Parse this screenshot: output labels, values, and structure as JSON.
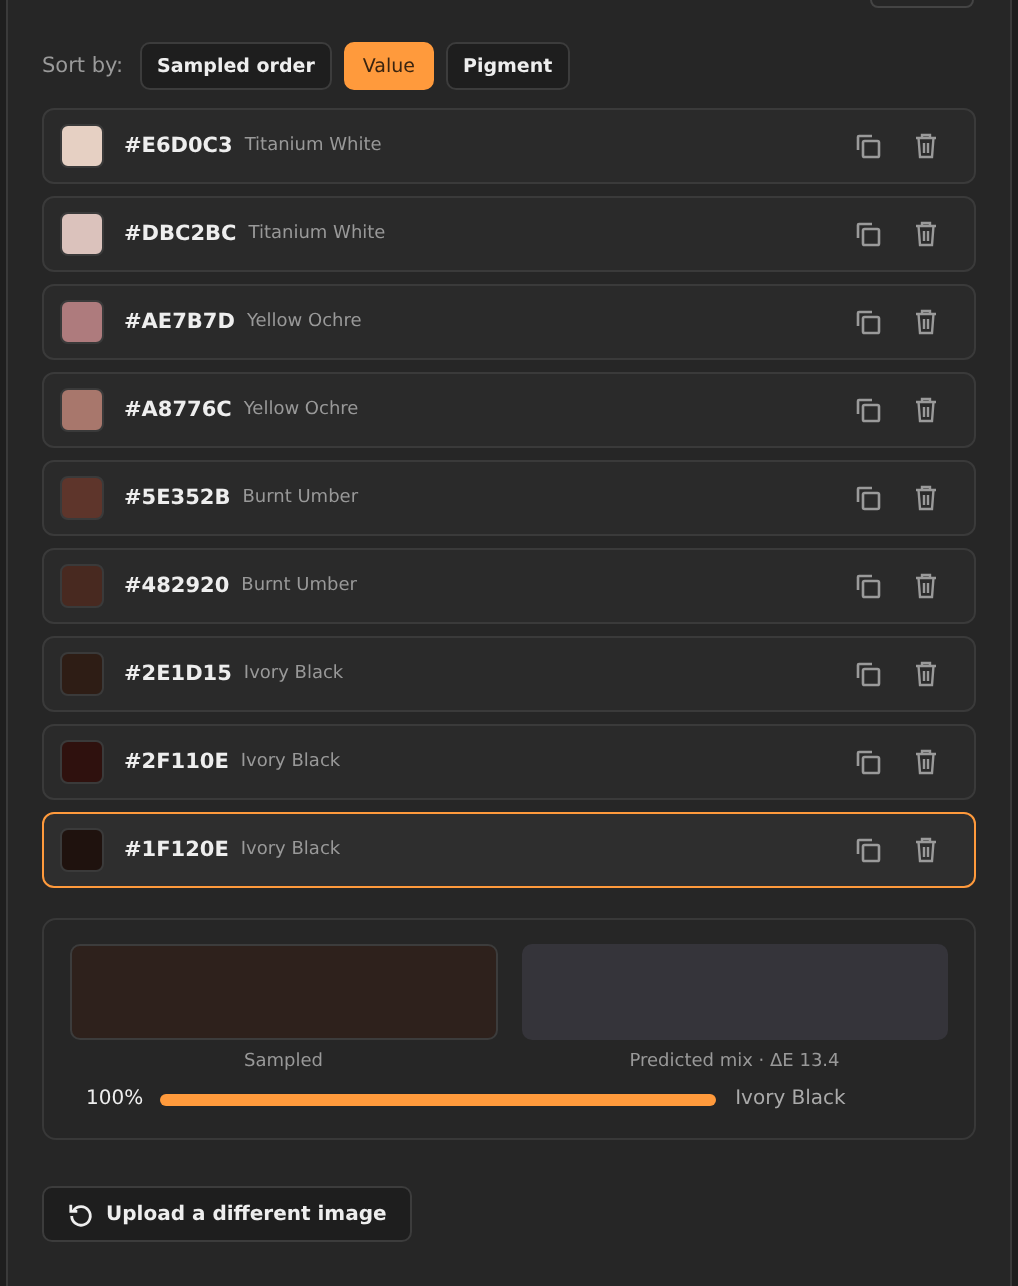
{
  "sort": {
    "label": "Sort by:",
    "options": [
      {
        "label": "Sampled order",
        "selected": false
      },
      {
        "label": "Value",
        "selected": true
      },
      {
        "label": "Pigment",
        "selected": false
      }
    ]
  },
  "rows": [
    {
      "hex": "#E6D0C3",
      "pigment": "Titanium White",
      "color": "#e6d0c3",
      "selected": false
    },
    {
      "hex": "#DBC2BC",
      "pigment": "Titanium White",
      "color": "#dbc2bc",
      "selected": false
    },
    {
      "hex": "#AE7B7D",
      "pigment": "Yellow Ochre",
      "color": "#ae7b7d",
      "selected": false
    },
    {
      "hex": "#A8776C",
      "pigment": "Yellow Ochre",
      "color": "#a8776c",
      "selected": false
    },
    {
      "hex": "#5E352B",
      "pigment": "Burnt Umber",
      "color": "#5e352b",
      "selected": false
    },
    {
      "hex": "#482920",
      "pigment": "Burnt Umber",
      "color": "#482920",
      "selected": false
    },
    {
      "hex": "#2E1D15",
      "pigment": "Ivory Black",
      "color": "#2e1d15",
      "selected": false
    },
    {
      "hex": "#2F110E",
      "pigment": "Ivory Black",
      "color": "#2f110e",
      "selected": false
    },
    {
      "hex": "#1F120E",
      "pigment": "Ivory Black",
      "color": "#1f120e",
      "selected": true
    }
  ],
  "mix": {
    "sampled": {
      "label": "Sampled",
      "color": "#2e211c"
    },
    "predicted": {
      "label": "Predicted mix · ΔE 13.4",
      "color": "#35343a"
    },
    "components": [
      {
        "percent": "100%",
        "pigment": "Ivory Black"
      }
    ]
  },
  "upload_button": "Upload a different image"
}
